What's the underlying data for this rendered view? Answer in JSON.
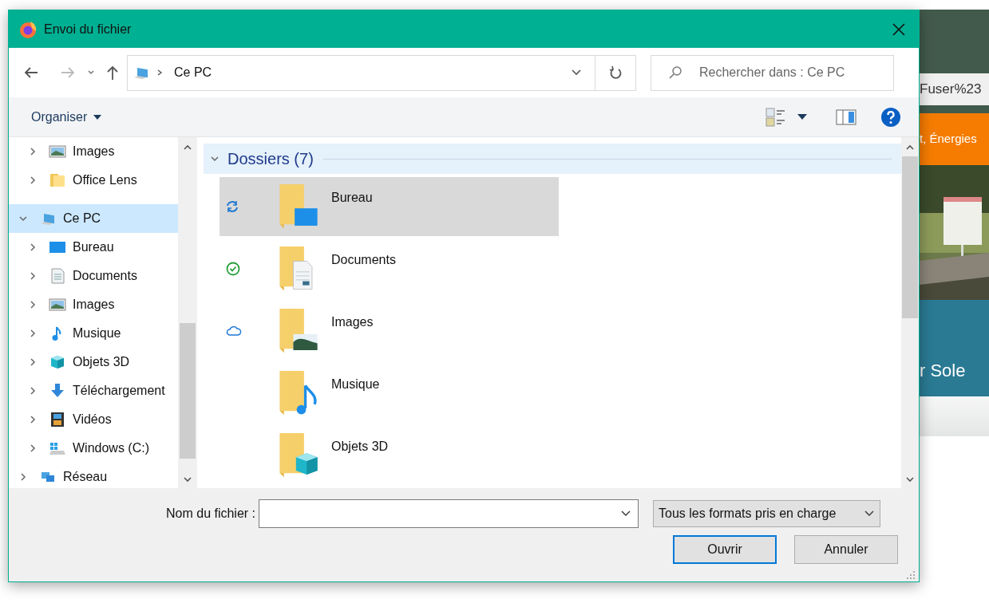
{
  "window": {
    "title": "Envoi du fichier"
  },
  "address": {
    "path": "Ce PC"
  },
  "search": {
    "placeholder": "Rechercher dans : Ce PC"
  },
  "toolbar": {
    "organise": "Organiser"
  },
  "sidebar": {
    "items_above": [
      {
        "label": "Images",
        "kind": "pictures",
        "expanded": false,
        "selected": false
      },
      {
        "label": "Office Lens",
        "kind": "folder",
        "expanded": false,
        "selected": false
      }
    ],
    "items": [
      {
        "label": "Ce PC",
        "kind": "pc",
        "expanded": true,
        "selected": true,
        "children": [
          {
            "label": "Bureau",
            "kind": "desktop",
            "expanded": false,
            "selected": false
          },
          {
            "label": "Documents",
            "kind": "documents",
            "expanded": false,
            "selected": false
          },
          {
            "label": "Images",
            "kind": "pictures",
            "expanded": false,
            "selected": false
          },
          {
            "label": "Musique",
            "kind": "music",
            "expanded": false,
            "selected": false
          },
          {
            "label": "Objets 3D",
            "kind": "objects3d",
            "expanded": false,
            "selected": false
          },
          {
            "label": "Téléchargement",
            "kind": "downloads",
            "expanded": false,
            "selected": false
          },
          {
            "label": "Vidéos",
            "kind": "videos",
            "expanded": false,
            "selected": false
          },
          {
            "label": "Windows (C:)",
            "kind": "drive",
            "expanded": false,
            "selected": false
          }
        ]
      },
      {
        "label": "Réseau",
        "kind": "network",
        "expanded": false,
        "selected": false
      }
    ]
  },
  "folders": {
    "title": "Dossiers (7)",
    "expanded": true,
    "items": [
      {
        "name": "Bureau",
        "kind": "desktop",
        "status": {
          "kind": "sync"
        },
        "selected": true
      },
      {
        "name": "Documents",
        "kind": "documents",
        "status": {
          "kind": "available"
        },
        "selected": false
      },
      {
        "name": "Images",
        "kind": "pictures",
        "status": {
          "kind": "cloud"
        },
        "selected": false
      },
      {
        "name": "Musique",
        "kind": "music",
        "selected": false
      },
      {
        "name": "Objets 3D",
        "kind": "objects3d",
        "selected": false
      }
    ]
  },
  "footer": {
    "filename_label": "Nom du fichier :",
    "filetype": "Tous les formats pris en charge",
    "buttons": [
      {
        "label": "Ouvrir",
        "default": true
      },
      {
        "label": "Annuler",
        "default": false
      }
    ]
  },
  "background_page": {
    "url_fragment": "Fuser%23",
    "banner": "t, Énergies",
    "heading": "r Sole"
  }
}
